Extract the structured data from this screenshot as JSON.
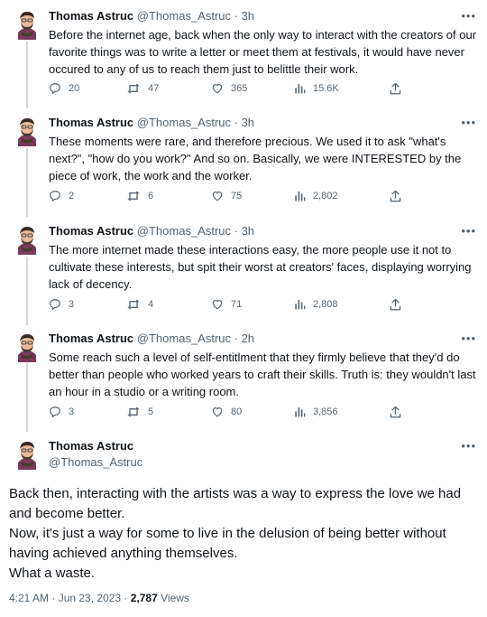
{
  "author": {
    "name": "Thomas Astruc",
    "handle": "@Thomas_Astruc"
  },
  "tweets": [
    {
      "meta": "@Thomas_Astruc · 3h",
      "text": "Before the internet age, back when the only way to interact with the creators of our favorite things was to write a letter or meet them at festivals, it would have never occured to any of us to reach them just to belittle their work.",
      "replies": "20",
      "retweets": "47",
      "likes": "365",
      "views": "15.6K"
    },
    {
      "meta": "@Thomas_Astruc · 3h",
      "text": "These moments were rare, and therefore precious. We used it to ask \"what's next?\", \"how do you work?\" And so on. Basically, we were INTERESTED by the piece of work, the work and  the worker.",
      "replies": "2",
      "retweets": "6",
      "likes": "75",
      "views": "2,802"
    },
    {
      "meta": "@Thomas_Astruc · 3h",
      "text": "The more internet made these interactions easy, the more people use it not to cultivate these interests, but spit their worst at creators' faces,  displaying worrying lack of decency.",
      "replies": "3",
      "retweets": "4",
      "likes": "71",
      "views": "2,808"
    },
    {
      "meta": "@Thomas_Astruc · 2h",
      "text": "Some reach such a level of self-entitlment that they firmly believe that they'd do better than people who worked years to craft their skills. Truth is: they wouldn't last an hour in a studio or a writing room.",
      "replies": "3",
      "retweets": "5",
      "likes": "80",
      "views": "3,856"
    }
  ],
  "main_tweet": {
    "lines": [
      "Back then, interacting with the artists was a way to express the love we had and become better.",
      "Now, it's just a way for some to live in  the delusion of being better without having achieved anything themselves.",
      "What a waste."
    ],
    "timestamp": "4:21 AM · Jun 23, 2023 · ",
    "views_count": "2,787",
    "views_label": " Views"
  },
  "more_label": "•••",
  "icons": [
    "reply-icon",
    "retweet-icon",
    "like-icon",
    "views-icon",
    "share-icon"
  ],
  "colors": {
    "text": "#0f1419",
    "secondary": "#536471",
    "thread_line": "#cfd9de"
  }
}
